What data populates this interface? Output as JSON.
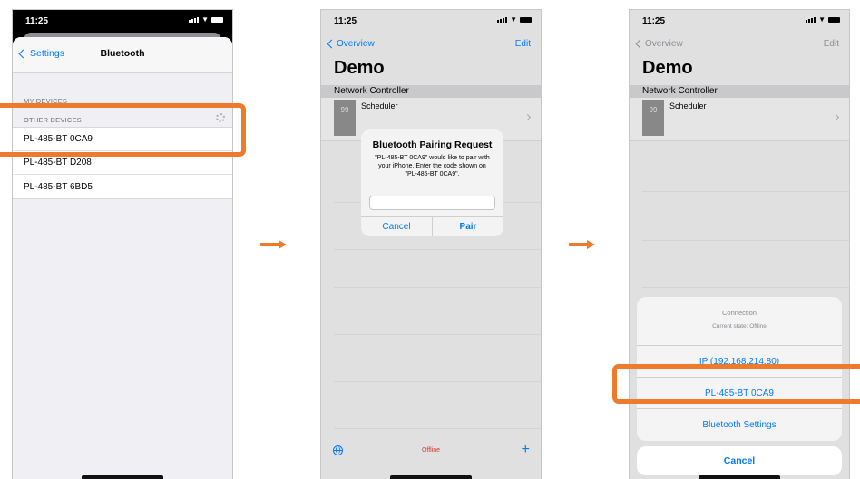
{
  "status_time": "11:25",
  "settings": {
    "back_label": "Settings",
    "title": "Bluetooth",
    "my_devices_header": "MY DEVICES",
    "other_devices_header": "OTHER DEVICES",
    "devices": [
      "PL-485-BT 0CA9",
      "PL-485-BT D208",
      "PL-485-BT 6BD5"
    ]
  },
  "app": {
    "back_label": "Overview",
    "edit_label": "Edit",
    "title": "Demo",
    "group_header": "Network Controller",
    "cell_title": "Scheduler",
    "cell_badge": "99",
    "status_text": "Offline",
    "plus_label": "+"
  },
  "pairing_alert": {
    "title": "Bluetooth Pairing Request",
    "message": "\"PL-485-BT 0CA9\" would like to pair with your iPhone. Enter the code shown on \"PL-485-BT 0CA9\".",
    "cancel_label": "Cancel",
    "pair_label": "Pair"
  },
  "connection_sheet": {
    "title": "Connection",
    "subtitle": "Current state: Offline",
    "options": [
      "IP (192.168.214.80)",
      "PL-485-BT 0CA9",
      "Bluetooth Settings"
    ],
    "cancel_label": "Cancel"
  },
  "colors": {
    "highlight": "#ee7a2c",
    "ios_blue": "#007aff",
    "offline_red": "#e0362c"
  }
}
